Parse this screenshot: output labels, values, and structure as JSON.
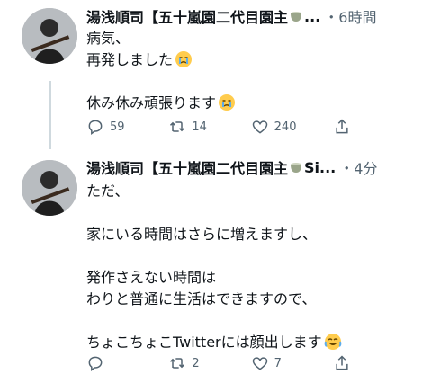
{
  "tweets": [
    {
      "author": "湯浅順司【五十嵐園二代目園主",
      "author_tail": "...",
      "separator": "・",
      "time": "6時間",
      "lines": [
        "病気、",
        "再発しました",
        "",
        "休み休み頑張ります"
      ],
      "emoji_after_line": [
        false,
        true,
        false,
        true
      ],
      "emoji": "crying-face",
      "replies": "59",
      "retweets": "14",
      "likes": "240",
      "share": ""
    },
    {
      "author": "湯浅順司【五十嵐園二代目園主",
      "author_tail": "Si...",
      "separator": "・",
      "time": "4分",
      "lines": [
        "ただ、",
        "",
        "家にいる時間はさらに増えますし、",
        "",
        "発作さえない時間は",
        "わりと普通に生活はできますので、",
        "",
        "ちょこちょこTwitterには顔出します"
      ],
      "emoji_after_line": [
        false,
        false,
        false,
        false,
        false,
        false,
        false,
        true
      ],
      "emoji": "tears-of-joy-face",
      "replies": "",
      "retweets": "2",
      "likes": "7",
      "share": ""
    }
  ],
  "colors": {
    "text": "#0f1419",
    "muted": "#536471",
    "thread_line": "#cfd9de",
    "emoji": "#ffcc4d",
    "teacup": "#9aa58a"
  }
}
